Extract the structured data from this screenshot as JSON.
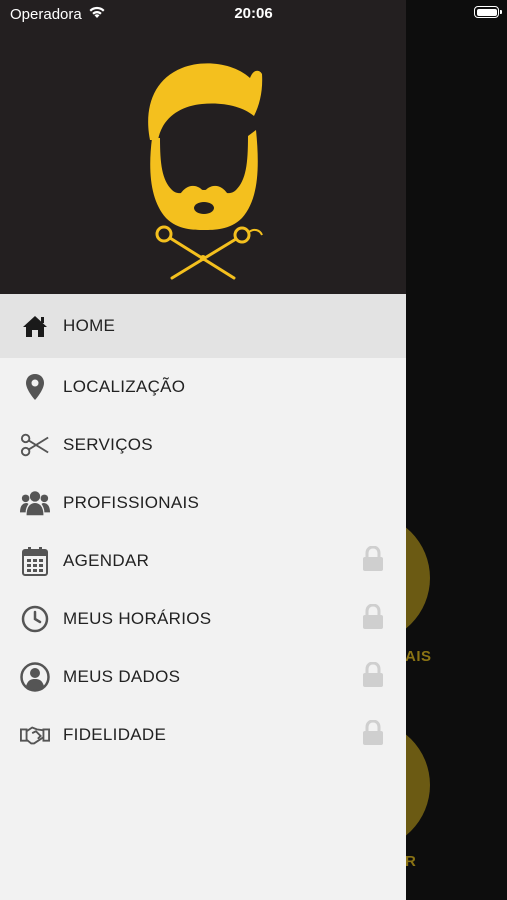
{
  "status_bar": {
    "carrier": "Operadora",
    "time": "20:06"
  },
  "colors": {
    "brand_yellow": "#F4C01E",
    "header_bg": "#231F20",
    "drawer_bg": "#F2F2F2",
    "active_bg": "#E3E3E3"
  },
  "menu": {
    "items": [
      {
        "label": "HOME",
        "icon": "home-icon",
        "active": true,
        "locked": false
      },
      {
        "label": "LOCALIZAÇÃO",
        "icon": "location-pin-icon",
        "active": false,
        "locked": false
      },
      {
        "label": "SERVIÇOS",
        "icon": "scissors-icon",
        "active": false,
        "locked": false
      },
      {
        "label": "PROFISSIONAIS",
        "icon": "group-icon",
        "active": false,
        "locked": false
      },
      {
        "label": "AGENDAR",
        "icon": "calendar-icon",
        "active": false,
        "locked": true
      },
      {
        "label": "MEUS HORÁRIOS",
        "icon": "clock-icon",
        "active": false,
        "locked": true
      },
      {
        "label": "MEUS DADOS",
        "icon": "user-icon",
        "active": false,
        "locked": true
      },
      {
        "label": "FIDELIDADE",
        "icon": "handshake-icon",
        "active": false,
        "locked": true
      }
    ]
  },
  "background": {
    "label_1": "AIS",
    "label_2": "R"
  }
}
